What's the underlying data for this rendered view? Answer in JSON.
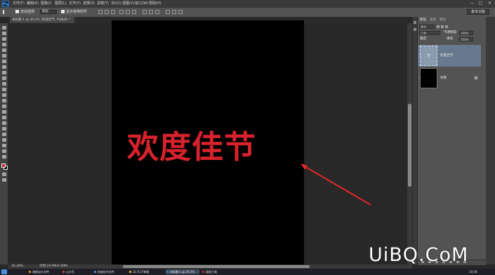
{
  "app": {
    "logo": "Ps",
    "menu": [
      "文件(F)",
      "编辑(E)",
      "图像(I)",
      "图层(L)",
      "文字(Y)",
      "选择(S)",
      "滤镜(T)",
      "3D(D)",
      "视图(V)",
      "窗口(W)",
      "帮助(H)"
    ],
    "window_controls": [
      "—",
      "□",
      "✕"
    ]
  },
  "options_bar": {
    "auto_select_label": "自动选择:",
    "auto_select_value": "图层",
    "show_transform_label": "显示变换控件",
    "workspace": "基本功能"
  },
  "document": {
    "tab_title": "未标题-1 @ 30.2% (欢度佳节, RGB/8) *",
    "headline": "欢度佳节",
    "canvas_color": "#000000",
    "text_color": "#d7222d"
  },
  "status_bar": {
    "zoom": "30.28%",
    "doc_info": "文档:24.9M/4.89M"
  },
  "layers_panel": {
    "tabs": [
      "图层",
      "通道",
      "路径"
    ],
    "kind_filter": "类型",
    "blend_mode": "正常",
    "opacity_label": "不透明度:",
    "opacity_value": "100%",
    "lock_label": "锁定:",
    "fill_label": "填充:",
    "fill_value": "100%",
    "layers": [
      {
        "name": "欢度佳节",
        "type": "text",
        "thumb_glyph": "T",
        "selected": true
      },
      {
        "name": "背景",
        "type": "background",
        "selected": false,
        "locked": true
      }
    ]
  },
  "taskbar": {
    "items": [
      {
        "label": "海报设计文件",
        "color": "#e0a020"
      },
      {
        "label": "公众号",
        "color": "#e04040"
      },
      {
        "label": "欢度佳节文件",
        "color": "#4a90e0"
      },
      {
        "label": "21.9.27海报",
        "color": "#f0c040"
      },
      {
        "label": "未标题-1 @ 30.2%",
        "color": "#2e7bd1"
      },
      {
        "label": "录屏工具",
        "color": "#d03030"
      }
    ],
    "clock": "10:36"
  },
  "watermark": "UiBQ.CoM"
}
